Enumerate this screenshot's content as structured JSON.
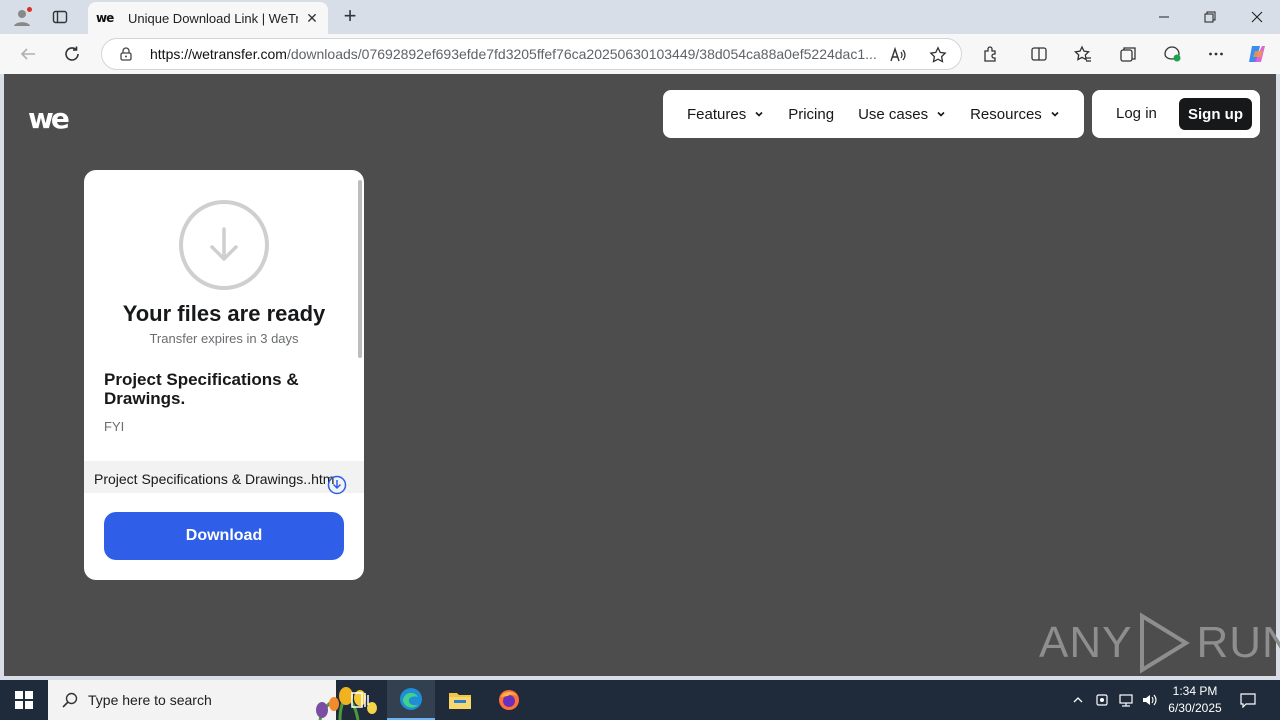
{
  "browser": {
    "tab_title": "Unique Download Link | WeTransfer",
    "tab_favicon_text": "we",
    "url_host": "https://wetransfer.com",
    "url_path": "/downloads/07692892ef693efde7fd3205ffef76ca20250630103449/38d054ca88a0ef5224dac1..."
  },
  "site": {
    "logo_text": "we",
    "nav": {
      "features": "Features",
      "pricing": "Pricing",
      "use_cases": "Use cases",
      "resources": "Resources"
    },
    "login": "Log in",
    "signup": "Sign up"
  },
  "card": {
    "title": "Your files are ready",
    "expires": "Transfer expires in 3 days",
    "transfer_title": "Project Specifications & Drawings.",
    "message": "FYI",
    "file_name": "Project Specifications & Drawings..htm",
    "download_label": "Download"
  },
  "watermark": {
    "left": "ANY",
    "right": "RUN"
  },
  "taskbar": {
    "search_placeholder": "Type here to search",
    "time": "1:34 PM",
    "date": "6/30/2025"
  },
  "colors": {
    "page_bg": "#4d4d4d",
    "download_button": "#2f5fe8",
    "signup_button": "#17181a",
    "taskbar": "#1f2a3a"
  }
}
